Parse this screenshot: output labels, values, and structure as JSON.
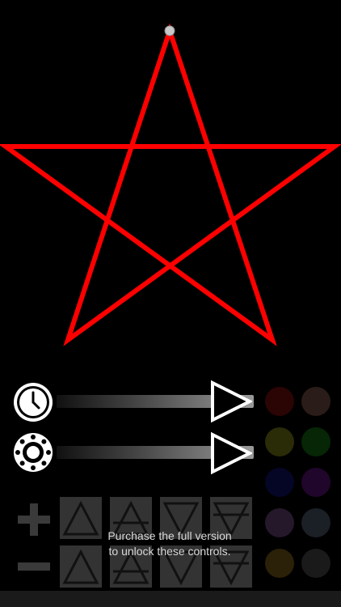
{
  "locked_message": {
    "line1": "Purchase the full version",
    "line2": "to unlock these controls."
  },
  "star": {
    "color": "#ff0000",
    "handle_color": "#bfbfbf"
  },
  "controls": {
    "speed": {
      "icon": "clock-icon",
      "play_icon": "play-icon"
    },
    "brightness": {
      "icon": "brightness-icon",
      "play_icon": "play-icon"
    }
  },
  "palette": [
    {
      "name": "red",
      "color": "#2b0404"
    },
    {
      "name": "brown",
      "color": "#2a1c19"
    },
    {
      "name": "olive",
      "color": "#2a2b07"
    },
    {
      "name": "green",
      "color": "#062606"
    },
    {
      "name": "blue",
      "color": "#050626"
    },
    {
      "name": "purple",
      "color": "#20062a"
    },
    {
      "name": "violet",
      "color": "#25182b"
    },
    {
      "name": "slate",
      "color": "#1b1f26"
    },
    {
      "name": "amber",
      "color": "#2b2108"
    },
    {
      "name": "gray",
      "color": "#1a1a1a"
    }
  ],
  "shape_tiles": [
    "up-triangle-icon",
    "up-triangle-bar-icon",
    "down-triangle-icon",
    "down-triangle-bar-icon"
  ],
  "stepper": {
    "plus": "plus-icon",
    "minus": "minus-icon"
  }
}
